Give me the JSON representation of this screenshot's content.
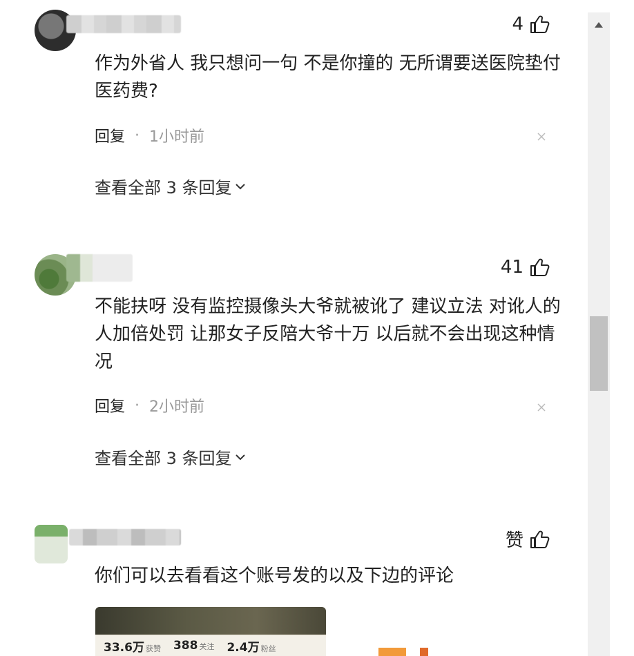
{
  "comments": [
    {
      "likes": "4",
      "text": "作为外省人 我只想问一句 不是你撞的 无所谓要送医院垫付医药费?",
      "reply_label": "回复",
      "dot": "·",
      "time": "1小时前",
      "expand": "查看全部 3 条回复"
    },
    {
      "likes": "41",
      "text": "不能扶呀 没有监控摄像头大爷就被讹了 建议立法 对讹人的人加倍处罚 让那女子反陪大爷十万 以后就不会出现这种情况",
      "reply_label": "回复",
      "dot": "·",
      "time": "2小时前",
      "expand": "查看全部 3 条回复"
    },
    {
      "likes": "赞",
      "text": "你们可以去看看这个账号发的以及下边的评论",
      "preview_stats": [
        {
          "value": "33.6万",
          "label": "获赞"
        },
        {
          "value": "388",
          "label": "关注"
        },
        {
          "value": "2.4万",
          "label": "粉丝"
        }
      ]
    }
  ],
  "icons": {
    "like": "thumbs-up-icon",
    "close": "close-icon",
    "expand": "chevron-down-icon",
    "scroll": "scroll-up-arrow-icon"
  },
  "colors": {
    "text": "#222222",
    "muted": "#999999",
    "scroll_track": "#f0f0f0",
    "scroll_thumb": "#c1c1c1"
  }
}
